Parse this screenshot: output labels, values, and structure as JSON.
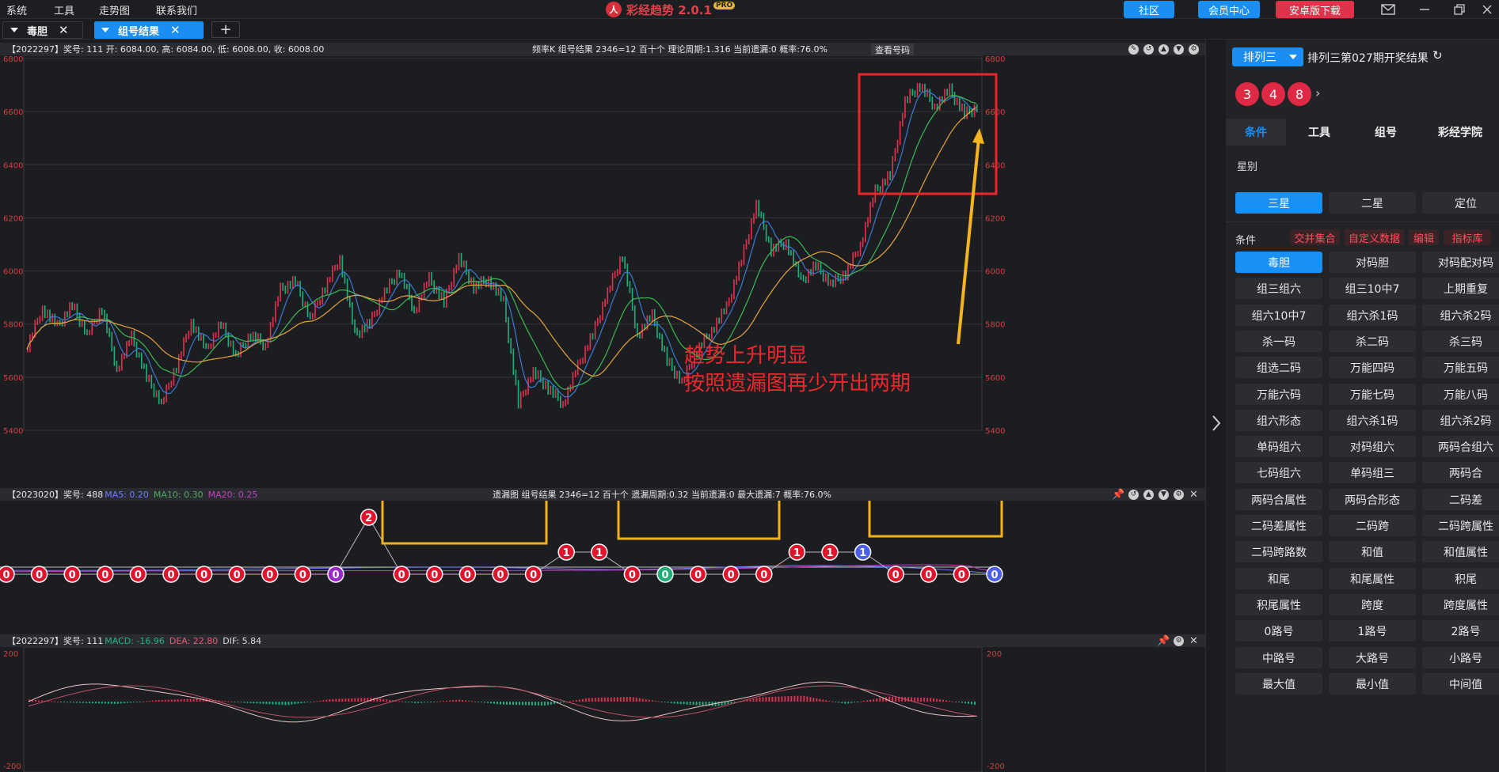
{
  "menu": [
    "系统",
    "工具",
    "走势图",
    "联系我们"
  ],
  "app": {
    "title": "彩经趋势 2.0.1",
    "badge": "PRO",
    "logo_text": "人"
  },
  "top_buttons": {
    "community": "社区",
    "member": "会员中心",
    "android": "安卓版下载"
  },
  "tabs": [
    {
      "label": "毒胆"
    },
    {
      "label": "组号结果"
    }
  ],
  "kline": {
    "info": "【2022297】奖号: 111  开: 6084.00, 高: 6084.00, 低: 6008.00, 收: 6008.00",
    "mid": "频率K  组号结果  2346=12  百十个  理论周期:1.316  当前遗漏:0  概率:76.0%",
    "view_button": "查看号码",
    "y_ticks": [
      "6800",
      "6600",
      "6400",
      "6200",
      "6000",
      "5800",
      "5600",
      "5400"
    ],
    "annotation_line1": "趋势上升明显",
    "annotation_line2": "按照遗漏图再少开出两期"
  },
  "chart_data": [
    {
      "type": "line",
      "title": "频率K",
      "y_ticks": [
        6800,
        6600,
        6400,
        6200,
        6000,
        5800,
        5600,
        5400
      ],
      "ylim": [
        5400,
        6800
      ],
      "series": [
        {
          "name": "收",
          "values": [
            5720,
            5860,
            5790,
            5870,
            5760,
            5860,
            5630,
            5750,
            5600,
            5500,
            5640,
            5810,
            5700,
            5800,
            5680,
            5760,
            5720,
            5930,
            5960,
            5820,
            5940,
            6050,
            5760,
            5800,
            5920,
            6000,
            5850,
            5970,
            5880,
            6050,
            5940,
            5970,
            5880,
            5500,
            5620,
            5560,
            5500,
            5640,
            5760,
            5920,
            6060,
            5760,
            5830,
            5660,
            5580,
            5700,
            5780,
            5860,
            6040,
            6250,
            6080,
            6110,
            5960,
            6020,
            5950,
            5990,
            6100,
            6300,
            6360,
            6640,
            6700,
            6620,
            6680,
            6590,
            6620
          ]
        }
      ]
    },
    {
      "type": "line",
      "title": "遗漏图",
      "x": [
        1,
        2,
        3,
        4,
        5,
        6,
        7,
        8,
        9,
        10,
        11,
        12,
        13,
        14,
        15,
        16,
        17,
        18,
        19,
        20,
        21,
        22,
        23,
        24,
        25,
        26,
        27,
        28,
        29,
        30
      ],
      "series": [
        {
          "name": "遗漏",
          "values": [
            0,
            0,
            0,
            0,
            0,
            0,
            0,
            0,
            0,
            0,
            0,
            2,
            0,
            0,
            0,
            0,
            0,
            1,
            1,
            0,
            0,
            0,
            0,
            0,
            1,
            1,
            1,
            0,
            0,
            0,
            0
          ]
        }
      ]
    },
    {
      "type": "bar",
      "title": "MACD",
      "y_ticks": [
        200,
        -200
      ],
      "ylim": [
        -200,
        200
      ],
      "series": [
        {
          "name": "MACD",
          "values": [
            10,
            -5,
            -12,
            8,
            15,
            -6,
            -18,
            12,
            20,
            -8,
            10,
            -15,
            -20,
            18,
            24,
            -10,
            -25,
            22,
            30,
            -12,
            26,
            18,
            -16
          ]
        }
      ]
    }
  ],
  "omission": {
    "info_prefix": "【2023020】奖号: 488 ",
    "ma5": "MA5: 0.20",
    "ma10": "MA10: 0.30",
    "ma20": "MA20: 0.25",
    "mid": "遗漏图  组号结果  2346=12  百十个  遗漏周期:0.32  当前遗漏:0  最大遗漏:7  概率:76.0%"
  },
  "macd": {
    "info_prefix": "【2022297】奖号: 111 ",
    "macd": "MACD: -16.96",
    "dea": "DEA: 22.80",
    "dif": "DIF: 5.84",
    "y_top": "200",
    "y_bottom": "-200"
  },
  "right": {
    "dropdown": "排列三",
    "result_title": "排列三第027期开奖结果",
    "balls": [
      "3",
      "4",
      "8"
    ],
    "tabs": [
      "条件",
      "工具",
      "组号",
      "彩经学院"
    ],
    "star_label": "星别",
    "star_buttons": [
      "三星",
      "二星",
      "定位"
    ],
    "cond_label": "条件",
    "cond_tags": [
      "交并集合",
      "自定义数据",
      "编辑",
      "指标库"
    ],
    "grid": [
      [
        "毒胆",
        "对码胆",
        "对码配对码"
      ],
      [
        "组三组六",
        "组三10中7",
        "上期重复"
      ],
      [
        "组六10中7",
        "组六杀1码",
        "组六杀2码"
      ],
      [
        "杀一码",
        "杀二码",
        "杀三码"
      ],
      [
        "组选二码",
        "万能四码",
        "万能五码"
      ],
      [
        "万能六码",
        "万能七码",
        "万能八码"
      ],
      [
        "组六形态",
        "组六杀1码",
        "组六杀2码"
      ],
      [
        "单码组六",
        "对码组六",
        "两码合组六"
      ],
      [
        "七码组六",
        "单码组三",
        "两码合"
      ],
      [
        "两码合属性",
        "两码合形态",
        "二码差"
      ],
      [
        "二码差属性",
        "二码跨",
        "二码跨属性"
      ],
      [
        "二码跨路数",
        "和值",
        "和值属性"
      ],
      [
        "和尾",
        "和尾属性",
        "积尾"
      ],
      [
        "积尾属性",
        "跨度",
        "跨度属性"
      ],
      [
        "0路号",
        "1路号",
        "2路号"
      ],
      [
        "中路号",
        "大路号",
        "小路号"
      ],
      [
        "最大值",
        "最小值",
        "中间值"
      ]
    ]
  }
}
